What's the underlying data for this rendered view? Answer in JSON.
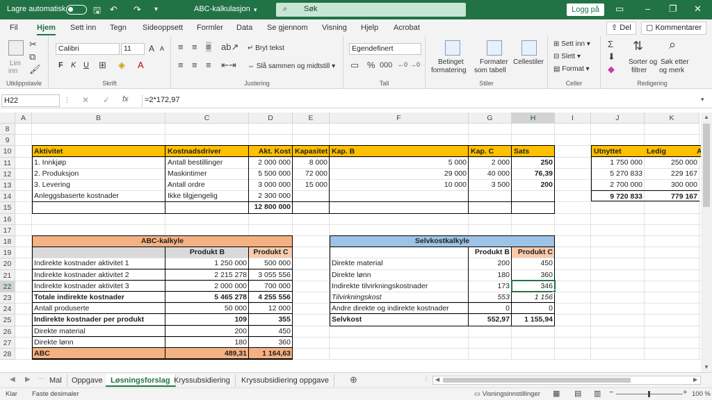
{
  "titlebar": {
    "autosave": "Lagre automatisk",
    "filename": "ABC-kalkulasjon",
    "search": "Søk",
    "login": "Logg på",
    "minimize": "–",
    "restore": "❐",
    "close": "✕"
  },
  "menu": {
    "tabs": [
      "Fil",
      "Hjem",
      "Sett inn",
      "Tegn",
      "Sideoppsett",
      "Formler",
      "Data",
      "Se gjennom",
      "Visning",
      "Hjelp",
      "Acrobat"
    ],
    "active": 1,
    "share": "Del",
    "comments": "Kommentarer"
  },
  "ribbon": {
    "clipboard": {
      "paste": "Lim",
      "paste2": "inn",
      "label": "Utklippstavle"
    },
    "font": {
      "name": "Calibri",
      "size": "11",
      "bold": "F",
      "italic": "K",
      "underline": "U",
      "grow": "A",
      "shrink": "A",
      "label": "Skrift"
    },
    "align": {
      "wrap": "Bryt tekst",
      "merge": "Slå sammen og midtstill",
      "label": "Justering"
    },
    "number": {
      "format": "Egendefinert",
      "label": "Tall"
    },
    "styles": {
      "cond": "Betinget",
      "cond2": "formatering",
      "table": "Formater",
      "table2": "som tabell",
      "cell": "Cellestiler",
      "label": "Stiler"
    },
    "cells": {
      "insert": "Sett inn",
      "delete": "Slett",
      "format": "Format",
      "label": "Celler"
    },
    "editing": {
      "sort": "Sorter og",
      "sort2": "filtrer",
      "find": "Søk etter",
      "find2": "og merk",
      "label": "Redigering"
    }
  },
  "formula_bar": {
    "namebox": "H22",
    "formula": "=2*172,97",
    "fx": "fx"
  },
  "columns": [
    "A",
    "B",
    "C",
    "D",
    "E",
    "F",
    "G",
    "H",
    "I",
    "J",
    "K"
  ],
  "rows": [
    "8",
    "9",
    "10",
    "11",
    "12",
    "13",
    "14",
    "15",
    "16",
    "17",
    "18",
    "19",
    "20",
    "21",
    "22",
    "23",
    "24",
    "25",
    "26",
    "27",
    "28"
  ],
  "selected": {
    "col": "H",
    "row": "22"
  },
  "table1": {
    "headers": [
      "Aktivitet",
      "Kostnadsdriver",
      "Akt. Kost",
      "Kapasitet",
      "Kap. B",
      "Kap. C",
      "Sats"
    ],
    "rows": [
      [
        "1. Innkjøp",
        "Antall bestillinger",
        "2 000 000",
        "8 000",
        "5 000",
        "2 000",
        "250"
      ],
      [
        "2. Produksjon",
        "Maskintimer",
        "5 500 000",
        "72 000",
        "29 000",
        "40 000",
        "76,39"
      ],
      [
        "3. Levering",
        "Antall ordre",
        "3 000 000",
        "15 000",
        "10 000",
        "3 500",
        "200"
      ],
      [
        "Anleggsbaserte kostnader",
        "Ikke tilgjengelig",
        "2 300 000",
        "",
        "",
        "",
        ""
      ]
    ],
    "total": "12 800 000"
  },
  "side_table": {
    "headers": [
      "Utnyttet",
      "Ledig",
      "A"
    ],
    "rows": [
      [
        "1 750 000",
        "250 000"
      ],
      [
        "5 270 833",
        "229 167"
      ],
      [
        "2 700 000",
        "300 000"
      ]
    ],
    "total": [
      "9 720 833",
      "779 167"
    ]
  },
  "abc": {
    "title": "ABC-kalkyle",
    "colB": "Produkt B",
    "colC": "Produkt C",
    "rows": [
      {
        "label": "Indirekte kostnader aktivitet 1",
        "b": "1 250 000",
        "c": "500 000",
        "bold": false
      },
      {
        "label": "Indirekte kostnader aktivitet 2",
        "b": "2 215 278",
        "c": "3 055 556",
        "bold": false
      },
      {
        "label": "Indirekte kostnader aktivitet 3",
        "b": "2 000 000",
        "c": "700 000",
        "bold": false
      },
      {
        "label": "Totale indirekte kostnader",
        "b": "5 465 278",
        "c": "4 255 556",
        "bold": true
      },
      {
        "label": "Antall produserte",
        "b": "50 000",
        "c": "12 000",
        "bold": false
      },
      {
        "label": "Indirekte kostnader per produkt",
        "b": "109",
        "c": "355",
        "bold": true
      },
      {
        "label": "Direkte material",
        "b": "200",
        "c": "450",
        "bold": false
      },
      {
        "label": "Direkte lønn",
        "b": "180",
        "c": "360",
        "bold": false
      },
      {
        "label": "ABC",
        "b": "489,31",
        "c": "1 164,63",
        "bold": true
      }
    ]
  },
  "selvkost": {
    "title": "Selvkostkalkyle",
    "colB": "Produkt B",
    "colC": "Produkt C",
    "rows": [
      {
        "label": "Direkte material",
        "b": "200",
        "c": "450",
        "style": ""
      },
      {
        "label": "Direkte lønn",
        "b": "180",
        "c": "360",
        "style": ""
      },
      {
        "label": "Indirekte tilvirkningskostnader",
        "b": "173",
        "c": "346",
        "style": ""
      },
      {
        "label": "Tilvirkningskost",
        "b": "553",
        "c": "1 156",
        "style": "italic"
      },
      {
        "label": "Andre direkte og indirekte kostnader",
        "b": "0",
        "c": "0",
        "style": ""
      },
      {
        "label": "Selvkost",
        "b": "552,97",
        "c": "1 155,94",
        "style": "bold"
      }
    ]
  },
  "sheets": [
    "Mal",
    "Oppgave",
    "Løsningsforslag",
    "Kryssubsidiering",
    "Kryssubsidiering oppgave"
  ],
  "active_sheet": 2,
  "status": {
    "ready": "Klar",
    "fixed": "Faste desimaler",
    "view": "Visningsinnstillinger",
    "zoom": "100 %"
  },
  "colors": {
    "green": "#217346",
    "yellow": "#ffc000",
    "orange": "#f4b183",
    "blue": "#9dc3e6",
    "salmon": "#f8cbad",
    "gray": "#d9d9d9"
  }
}
